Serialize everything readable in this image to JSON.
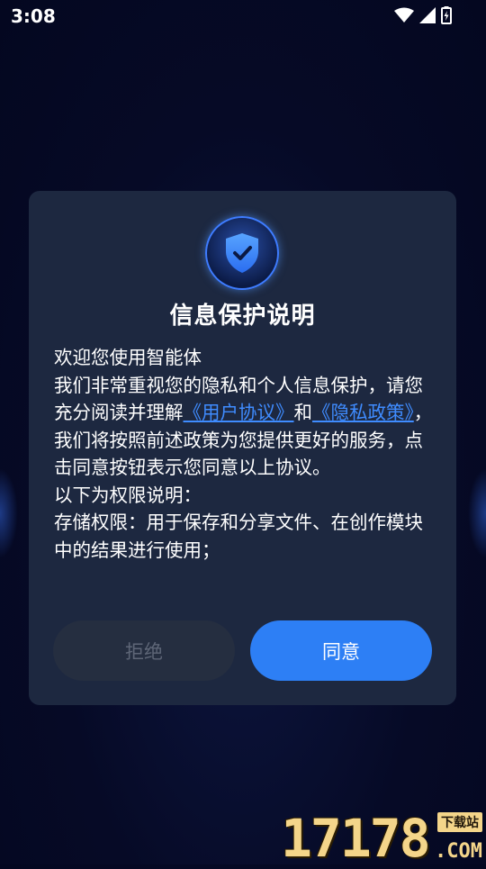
{
  "status_bar": {
    "time": "3:08",
    "icons": [
      "wifi-icon",
      "signal-icon",
      "battery-charging-icon"
    ]
  },
  "dialog": {
    "icon": "shield-check-icon",
    "title": "信息保护说明",
    "greeting": "欢迎您使用智能体",
    "paragraph_1_pre": "我们非常重视您的隐私和个人信息保护，请您充分阅读并理解",
    "link_user_agreement": "《用户协议》",
    "paragraph_1_and": "和",
    "link_privacy_policy": "《隐私政策》",
    "paragraph_1_post": "，我们将按照前述政策为您提供更好的服务，点击同意按钮表示您同意以上协议。",
    "permissions_heading": "以下为权限说明：",
    "storage_permission": "存储权限：用于保存和分享文件、在创作模块中的结果进行使用；",
    "reject_label": "拒绝",
    "agree_label": "同意"
  },
  "watermark": {
    "number": "17178",
    "tag": "下载站",
    "domain": ".COM"
  },
  "colors": {
    "background": "#060a26",
    "dialog": "#1d2840",
    "accent": "#2d7ff5",
    "link": "#3f8cff"
  }
}
